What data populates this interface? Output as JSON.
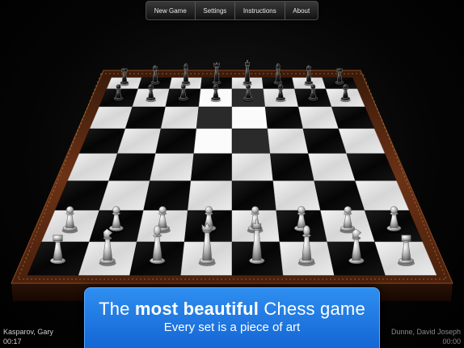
{
  "menu": {
    "items": [
      {
        "id": "new-game",
        "label": "New Game"
      },
      {
        "id": "settings",
        "label": "Settings"
      },
      {
        "id": "instructions",
        "label": "Instructions"
      },
      {
        "id": "about",
        "label": "About"
      }
    ]
  },
  "banner": {
    "title_pre": "The ",
    "title_bold": "most beautiful",
    "title_post": " Chess game",
    "subtitle": "Every set is a piece of art"
  },
  "players": {
    "white": {
      "name": "Kasparov, Gary",
      "clock": "00:17"
    },
    "black": {
      "name": "Dunne, David Joseph",
      "clock": "00:00"
    }
  },
  "board": {
    "light_square_color": "#e6e6e6",
    "dark_square_color": "#0c0c0c",
    "frame_color": "#5a2a12",
    "highlighted_squares": [
      "d7",
      "e7",
      "d6",
      "e6",
      "d5",
      "e5"
    ],
    "pieces": [
      {
        "square": "a8",
        "piece": "rook",
        "color": "black"
      },
      {
        "square": "b8",
        "piece": "knight",
        "color": "black"
      },
      {
        "square": "c8",
        "piece": "bishop",
        "color": "black"
      },
      {
        "square": "d8",
        "piece": "queen",
        "color": "black"
      },
      {
        "square": "e8",
        "piece": "king",
        "color": "black"
      },
      {
        "square": "f8",
        "piece": "bishop",
        "color": "black"
      },
      {
        "square": "g8",
        "piece": "knight",
        "color": "black"
      },
      {
        "square": "h8",
        "piece": "rook",
        "color": "black"
      },
      {
        "square": "a7",
        "piece": "pawn",
        "color": "black"
      },
      {
        "square": "b7",
        "piece": "pawn",
        "color": "black"
      },
      {
        "square": "c7",
        "piece": "pawn",
        "color": "black"
      },
      {
        "square": "d7",
        "piece": "pawn",
        "color": "black"
      },
      {
        "square": "e7",
        "piece": "pawn",
        "color": "black"
      },
      {
        "square": "f7",
        "piece": "pawn",
        "color": "black"
      },
      {
        "square": "g7",
        "piece": "pawn",
        "color": "black"
      },
      {
        "square": "h7",
        "piece": "pawn",
        "color": "black"
      },
      {
        "square": "a2",
        "piece": "pawn",
        "color": "white"
      },
      {
        "square": "b2",
        "piece": "pawn",
        "color": "white"
      },
      {
        "square": "c2",
        "piece": "pawn",
        "color": "white"
      },
      {
        "square": "d2",
        "piece": "pawn",
        "color": "white"
      },
      {
        "square": "e2",
        "piece": "pawn",
        "color": "white"
      },
      {
        "square": "f2",
        "piece": "pawn",
        "color": "white"
      },
      {
        "square": "g2",
        "piece": "pawn",
        "color": "white"
      },
      {
        "square": "h2",
        "piece": "pawn",
        "color": "white"
      },
      {
        "square": "a1",
        "piece": "rook",
        "color": "white"
      },
      {
        "square": "b1",
        "piece": "knight",
        "color": "white"
      },
      {
        "square": "c1",
        "piece": "bishop",
        "color": "white"
      },
      {
        "square": "d1",
        "piece": "queen",
        "color": "white"
      },
      {
        "square": "e1",
        "piece": "king",
        "color": "white"
      },
      {
        "square": "f1",
        "piece": "bishop",
        "color": "white"
      },
      {
        "square": "g1",
        "piece": "knight",
        "color": "white"
      },
      {
        "square": "h1",
        "piece": "rook",
        "color": "white"
      }
    ]
  }
}
